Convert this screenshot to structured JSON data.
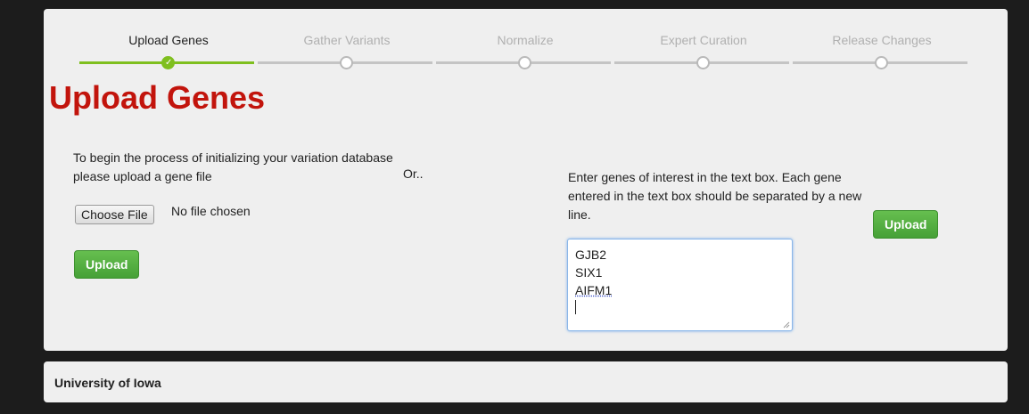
{
  "steps": [
    {
      "label": "Upload Genes",
      "active": true
    },
    {
      "label": "Gather Variants",
      "active": false
    },
    {
      "label": "Normalize",
      "active": false
    },
    {
      "label": "Expert Curation",
      "active": false
    },
    {
      "label": "Release Changes",
      "active": false
    }
  ],
  "page_title": "Upload Genes",
  "left_panel": {
    "instructions": "To begin the process of initializing your variation database please upload a gene file",
    "choose_file_label": "Choose File",
    "file_status": "No file chosen",
    "upload_label": "Upload"
  },
  "separator_text": "Or..",
  "right_panel": {
    "instructions": "Enter genes of interest in the text box. Each gene entered in the text box should be separated by a new line.",
    "genes": [
      "GJB2",
      "SIX1",
      "AIFM1"
    ],
    "upload_label": "Upload"
  },
  "footer": {
    "text": "University of Iowa"
  },
  "colors": {
    "accent_green": "#7fbf1f",
    "button_green": "#4cae3c",
    "title_red": "#c2140c",
    "focus_blue": "#8ab6e8"
  }
}
